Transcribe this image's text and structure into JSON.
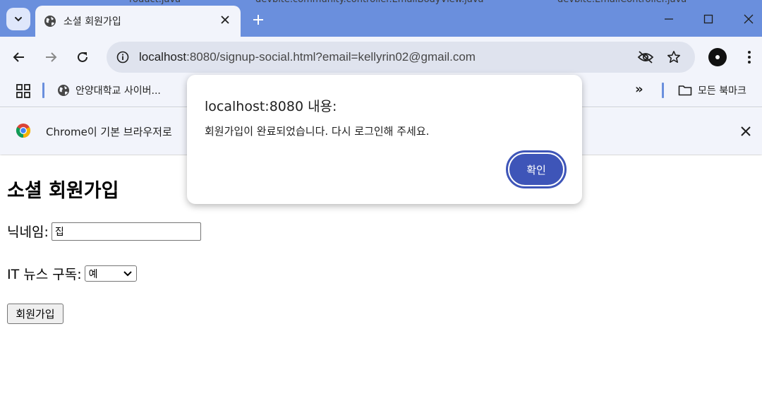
{
  "browser": {
    "tab": {
      "title": "소셜 회원가입"
    },
    "ghost_tabs": [
      "roduct.java",
      "devbite.community.controller.EmailBodyView.java",
      "devbite.EmailController.java"
    ],
    "address_bar": {
      "host": "localhost",
      "path": ":8080/signup-social.html?email=kellyrin02@gmail.com"
    },
    "bookmarks": [
      {
        "label": "안양대학교 사이버..."
      },
      {
        "label": "모든 북마크"
      }
    ],
    "bookmarks_overflow_label": "»",
    "bookmark_truncated": "."
  },
  "infobar": {
    "text": "Chrome이 기본 브라우저로"
  },
  "page": {
    "heading": "소셜 회원가입",
    "nickname": {
      "label": "닉네임:",
      "value": "집"
    },
    "newsletter": {
      "label": "IT 뉴스 구독:",
      "selected": "예"
    },
    "submit_label": "회원가입"
  },
  "dialog": {
    "title": "localhost:8080 내용:",
    "message": "회원가입이 완료되었습니다. 다시 로그인해 주세요.",
    "ok_label": "확인"
  },
  "colors": {
    "tabstrip": "#6a8fdd",
    "toolbar": "#f2f4fb",
    "accent_button": "#3e55b8"
  }
}
